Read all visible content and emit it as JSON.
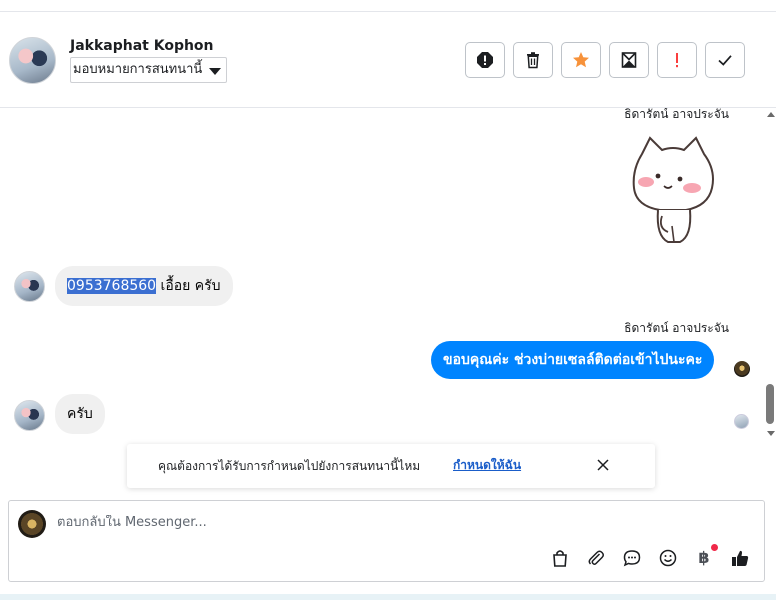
{
  "header": {
    "contact_name": "Jakkaphat Kophon",
    "assign_label": "มอบหมายการสนทนานี้",
    "actions": [
      {
        "name": "mark-spam-icon"
      },
      {
        "name": "trash-icon"
      },
      {
        "name": "star-icon",
        "color": "#f7923a"
      },
      {
        "name": "mark-unread-icon"
      },
      {
        "name": "follow-up-icon",
        "color": "#fa3e3e"
      },
      {
        "name": "done-check-icon"
      }
    ]
  },
  "thread": {
    "sender_top": "ธิดารัตน์ อาจประจัน",
    "msg_phone_highlight": "0953768560",
    "msg_phone_rest": " เอื้อย ครับ",
    "sender_mid": "ธิดารัตน์ อาจประจัน",
    "msg_out": "ขอบคุณค่ะ ช่วงบ่ายเซลล์ติดต่อเข้าไปนะคะ",
    "msg_in_last": "ครับ"
  },
  "banner": {
    "text": "คุณต้องการได้รับการกำหนดไปยังการสนทนานี้ไหม",
    "link": "กำหนดให้ฉัน"
  },
  "composer": {
    "placeholder": "ตอบกลับใน Messenger...",
    "baht": "฿",
    "tools": [
      "shopping-bag-icon",
      "paperclip-icon",
      "saved-reply-icon",
      "emoji-icon",
      "baht-icon",
      "thumbs-up-icon"
    ]
  },
  "colors": {
    "outgoing_bubble": "#0084ff",
    "link": "#1a5dc9",
    "highlight": "#3b6fd1",
    "notification_dot": "#f02849"
  }
}
